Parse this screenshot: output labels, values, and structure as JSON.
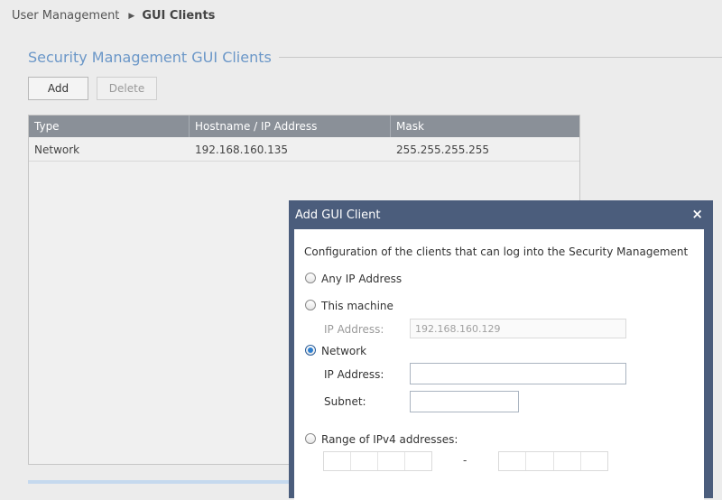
{
  "breadcrumb": {
    "parent": "User Management",
    "current": "GUI Clients"
  },
  "section": {
    "title": "Security Management GUI Clients"
  },
  "toolbar": {
    "add_label": "Add",
    "delete_label": "Delete"
  },
  "table": {
    "columns": [
      "Type",
      "Hostname / IP Address",
      "Mask"
    ],
    "rows": [
      [
        "Network",
        "192.168.160.135",
        "255.255.255.255"
      ]
    ]
  },
  "dialog": {
    "title": "Add GUI Client",
    "close_icon": "×",
    "description": "Configuration of the clients that can log into the Security Management",
    "options": {
      "any_ip": "Any IP Address",
      "this_machine": "This machine",
      "network": "Network",
      "range": "Range of IPv4 addresses:"
    },
    "selected_option": "network",
    "this_machine": {
      "ip_label": "IP Address:",
      "ip_value": "192.168.160.129"
    },
    "network": {
      "ip_label": "IP Address:",
      "ip_value": "",
      "subnet_label": "Subnet:",
      "subnet_value": ""
    },
    "range": {
      "separator": "-"
    }
  }
}
